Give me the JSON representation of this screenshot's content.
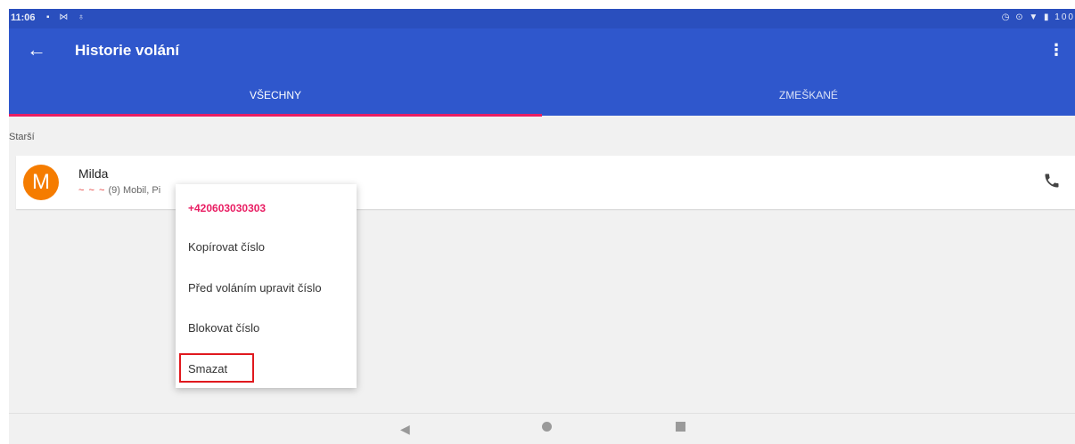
{
  "status_bar": {
    "time": "11:06",
    "left_icons": "▪ ⋈ ♁",
    "right_icons": "◷ ⊙ ▼ ▮ 100"
  },
  "app_bar": {
    "title": "Historie volání",
    "back_icon": "←",
    "more_icon": "⋮"
  },
  "tabs": [
    {
      "label": "VŠECHNY",
      "selected": true
    },
    {
      "label": "ZMEŠKANÉ",
      "selected": false
    }
  ],
  "section_header": "Starší",
  "call_entry": {
    "avatar_letter": "M",
    "name": "Milda",
    "missed_icons": "~ ~ ~",
    "detail": "(9) Mobil, Pi"
  },
  "context_menu": {
    "number": "+420603030303",
    "items": [
      {
        "label": "Kopírovat číslo"
      },
      {
        "label": "Před voláním upravit číslo"
      },
      {
        "label": "Blokovat číslo"
      },
      {
        "label": "Smazat"
      }
    ]
  },
  "colors": {
    "primary": "#2f57cc",
    "accent": "#e91e63",
    "avatar": "#f57c00",
    "highlight": "#e0191e"
  }
}
